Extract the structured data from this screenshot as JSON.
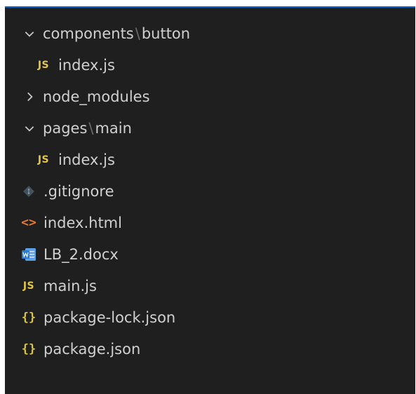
{
  "explorer": {
    "items": [
      {
        "type": "folder",
        "expanded": true,
        "parts": [
          "components",
          "button"
        ],
        "icon": "chevron-down-icon"
      },
      {
        "type": "file",
        "label": "index.js",
        "icon": "js-icon",
        "badge": "JS"
      },
      {
        "type": "folder",
        "expanded": false,
        "label": "node_modules",
        "icon": "chevron-right-icon"
      },
      {
        "type": "folder",
        "expanded": true,
        "parts": [
          "pages",
          "main"
        ],
        "icon": "chevron-down-icon"
      },
      {
        "type": "file",
        "label": "index.js",
        "icon": "js-icon",
        "badge": "JS"
      },
      {
        "type": "file",
        "label": ".gitignore",
        "icon": "git-icon"
      },
      {
        "type": "file",
        "label": "index.html",
        "icon": "html-icon",
        "badge": "<>"
      },
      {
        "type": "file",
        "label": "LB_2.docx",
        "icon": "word-icon"
      },
      {
        "type": "file",
        "label": "main.js",
        "icon": "js-icon",
        "badge": "JS"
      },
      {
        "type": "file",
        "label": "package-lock.json",
        "icon": "json-icon",
        "badge": "{}"
      },
      {
        "type": "file",
        "label": "package.json",
        "icon": "json-icon",
        "badge": "{}"
      }
    ],
    "separator": "\\"
  },
  "colors": {
    "panel_bg": "#1f1f1f",
    "focus_border": "#0a64c8",
    "text": "#d0d0d0",
    "js": "#e3c54a",
    "json": "#d9c43f",
    "html": "#e37933",
    "word": "#2b7cd3"
  }
}
